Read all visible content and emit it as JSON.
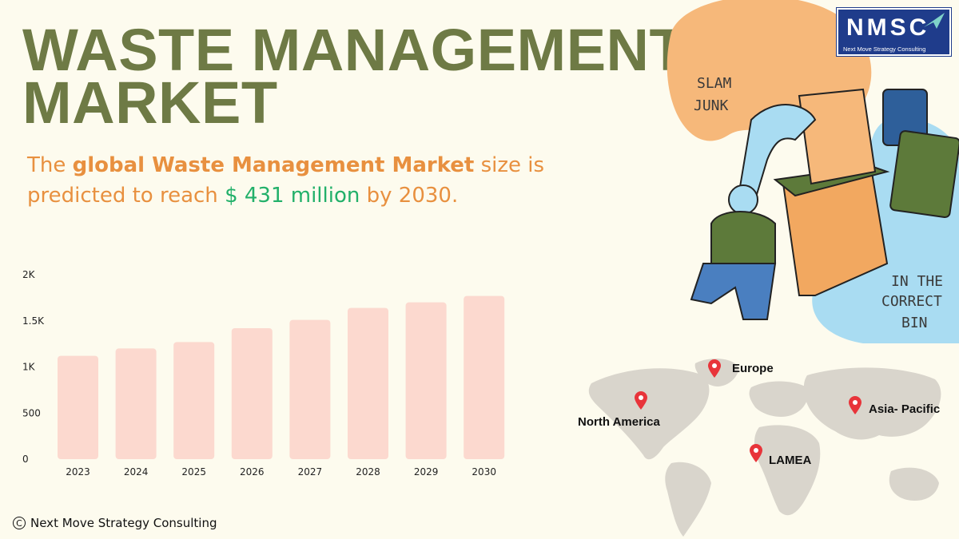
{
  "title": {
    "line1": "WASTE MANAGEMENT",
    "line2": "MARKET"
  },
  "subtitle": {
    "prefix": "The ",
    "bold": "global Waste Management Market",
    "middle": " size is predicted to reach ",
    "value": "$ 431 million",
    "suffix": " by 2030."
  },
  "chart_data": {
    "type": "bar",
    "categories": [
      "2023",
      "2024",
      "2025",
      "2026",
      "2027",
      "2028",
      "2029",
      "2030"
    ],
    "values": [
      1120,
      1200,
      1270,
      1420,
      1510,
      1640,
      1700,
      1770
    ],
    "y_tick_labels": [
      "0",
      "500",
      "1K",
      "1.5K",
      "2K"
    ],
    "y_ticks": [
      0,
      500,
      1000,
      1500,
      2000
    ],
    "ylim": [
      0,
      2000
    ],
    "bar_color": "#fcd9cf",
    "grid": false
  },
  "illustration": {
    "text1": [
      "SLAM",
      "JUNK"
    ],
    "text2": [
      "IN THE",
      "CORRECT",
      "BIN"
    ],
    "colors": {
      "orange": "#f6b87a",
      "blue": "#a9dcf2",
      "green": "#5d7a3a",
      "box": "#f2a860"
    }
  },
  "map": {
    "regions": [
      "Europe",
      "North America",
      "Asia- Pacific",
      "LAMEA"
    ],
    "land_color": "#d9d5cc",
    "pin_color": "#e8343a"
  },
  "logo": {
    "text": "NMSC",
    "subtitle": "Next Move Strategy Consulting",
    "color": "#1f3c8b"
  },
  "footer": {
    "text": "Next Move Strategy Consulting",
    "icon": "copyright-icon"
  }
}
